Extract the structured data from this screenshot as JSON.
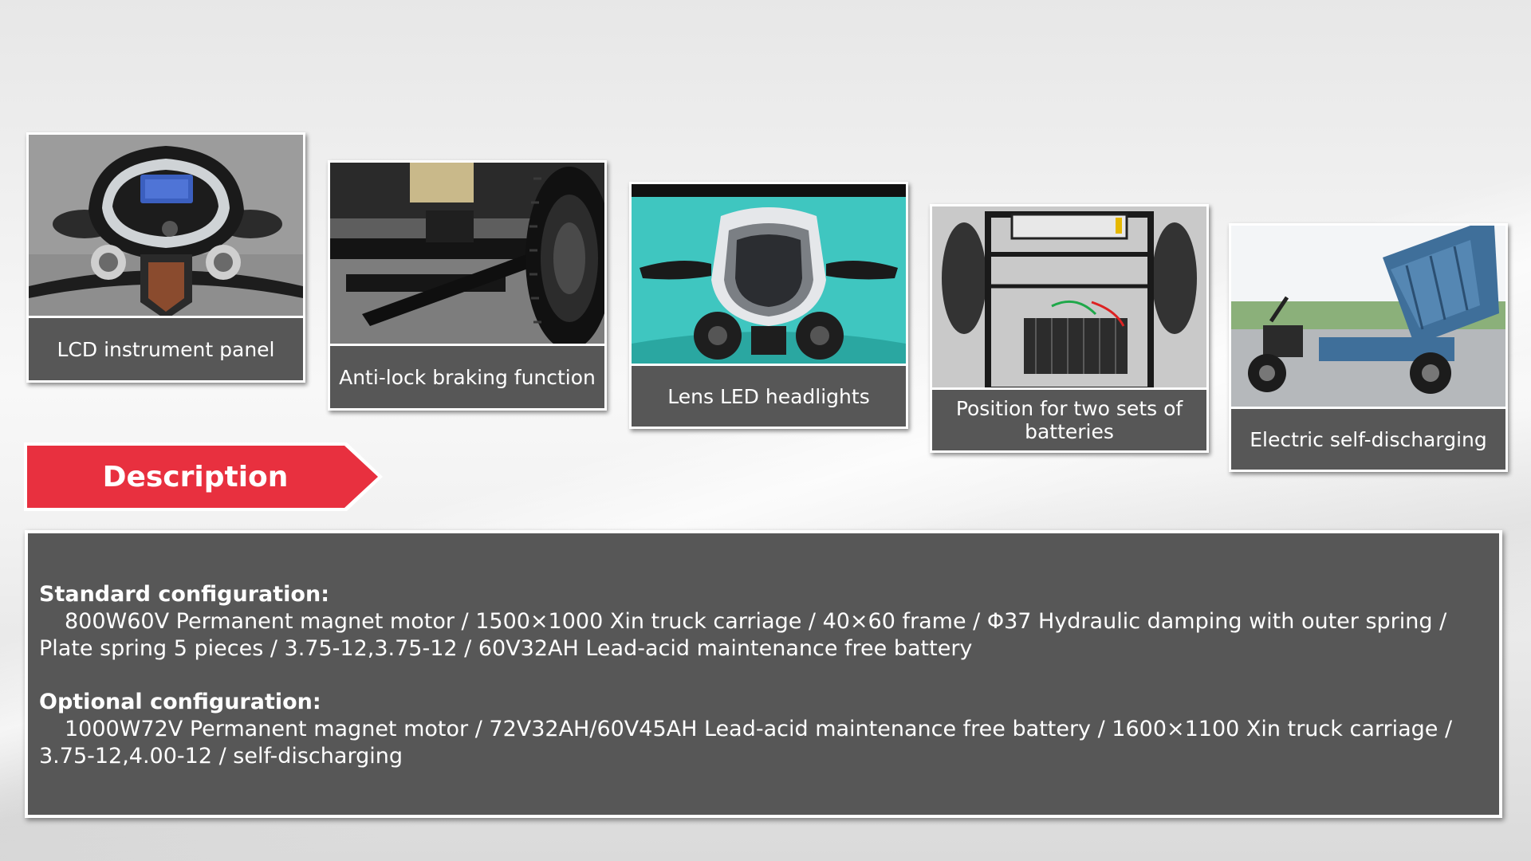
{
  "features": [
    {
      "caption": "LCD instrument panel"
    },
    {
      "caption": "Anti-lock braking function"
    },
    {
      "caption": "Lens LED headlights"
    },
    {
      "caption": "Position for two sets of batteries"
    },
    {
      "caption": "Electric self-discharging"
    }
  ],
  "description": {
    "title": "Description"
  },
  "standard": {
    "heading": "Standard configuration:",
    "text": "800W60V Permanent magnet motor / 1500×1000 Xin truck carriage / 40×60 frame / Φ37 Hydraulic damping with outer spring / Plate spring 5 pieces / 3.75-12,3.75-12 / 60V32AH Lead-acid maintenance free battery"
  },
  "optional": {
    "heading": "Optional configuration:",
    "text": "1000W72V Permanent magnet motor / 72V32AH/60V45AH Lead-acid maintenance free battery / 1600×1100 Xin truck carriage / 3.75-12,4.00-12 / self-discharging"
  },
  "colors": {
    "banner_red": "#e8303f",
    "panel_gray": "#575757",
    "headlight_teal": "#3fc6c0",
    "carriage_blue": "#3f6f9a"
  }
}
